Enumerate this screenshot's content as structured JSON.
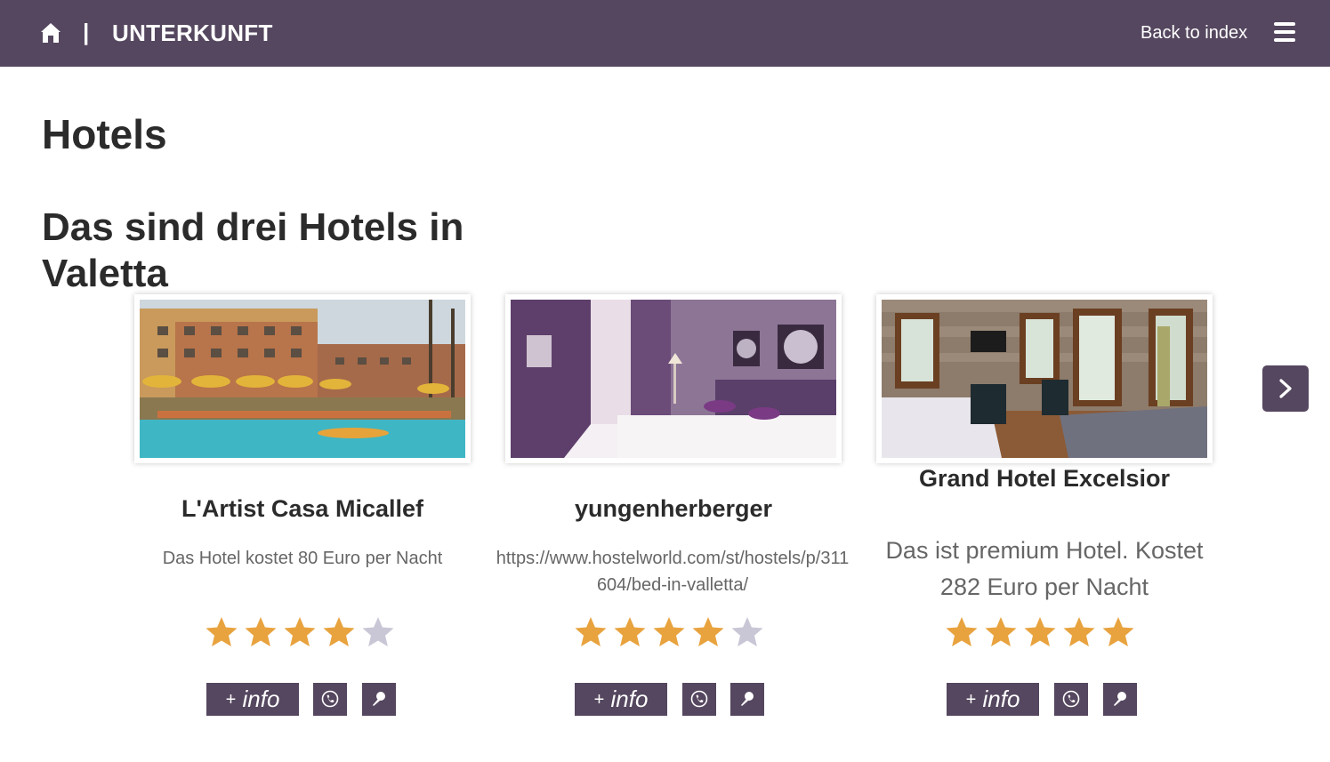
{
  "header": {
    "separator": "|",
    "title": "UNTERKUNFT",
    "back_label": "Back to index"
  },
  "page_title": "Hotels",
  "section_title": "Das sind drei Hotels in Valetta",
  "colors": {
    "header_bg": "#55475f",
    "button_bg": "#55475f",
    "star_filled": "#e8a33f",
    "star_empty": "#c9c6d6"
  },
  "hotels": [
    {
      "name": "L'Artist Casa Micallef",
      "description": "Das Hotel kostet 80 Euro per Nacht",
      "rating": 4,
      "rating_max": 5,
      "info_label": "info",
      "info_prefix": "+"
    },
    {
      "name": "yungenherberger",
      "description": "https://www.hostelworld.com/st/hostels/p/311604/bed-in-valletta/",
      "rating": 4,
      "rating_max": 5,
      "info_label": "info",
      "info_prefix": "+"
    },
    {
      "name": "Grand Hotel Excelsior",
      "description": "Das ist premium Hotel. Kostet 282 Euro per Nacht",
      "rating": 5,
      "rating_max": 5,
      "info_label": "info",
      "info_prefix": "+"
    }
  ],
  "icons": {
    "home": "home-icon",
    "menu": "hamburger-menu-icon",
    "phone": "phone-icon",
    "map_pin": "map-pin-icon",
    "next": "chevron-right-icon"
  }
}
